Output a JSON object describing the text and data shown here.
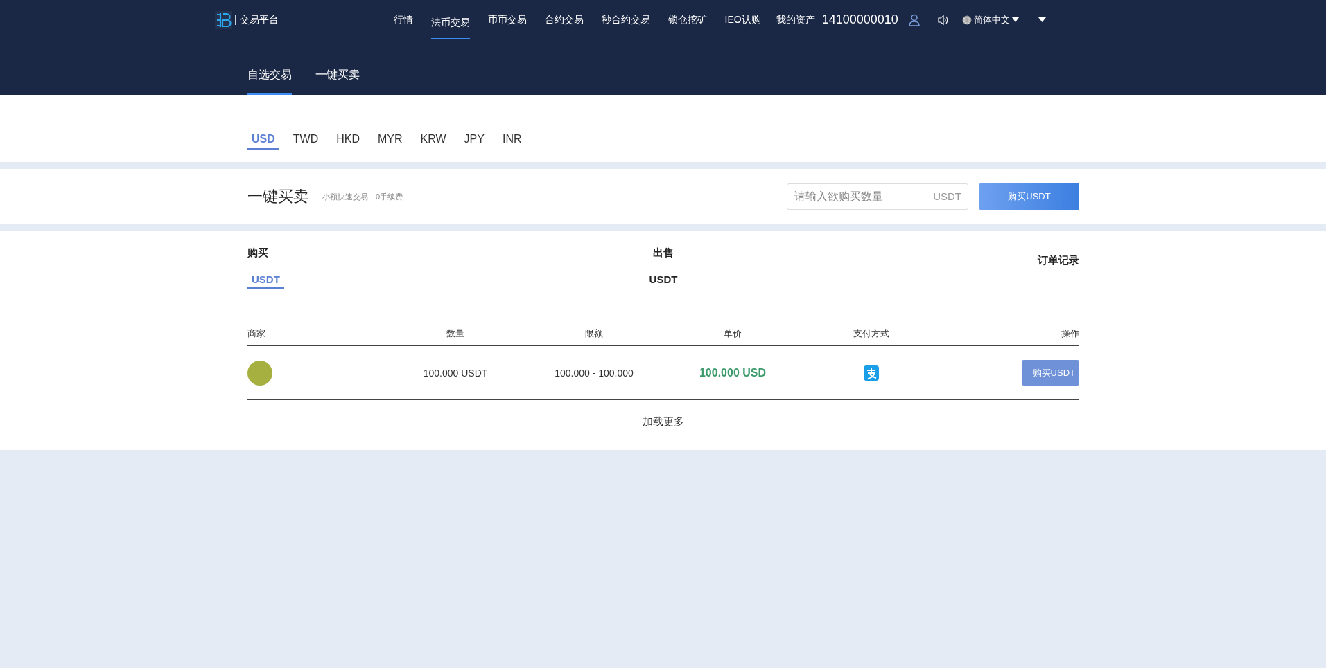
{
  "header": {
    "brand": "| 交易平台",
    "nav": [
      {
        "label": "行情",
        "selected": false
      },
      {
        "label": "法币交易",
        "selected": true
      },
      {
        "label": "币币交易",
        "selected": false
      },
      {
        "label": "合约交易",
        "selected": false
      },
      {
        "label": "秒合约交易",
        "selected": false
      },
      {
        "label": "锁仓挖矿",
        "selected": false
      },
      {
        "label": "IEO认购",
        "selected": false
      }
    ],
    "assets": "我的资产",
    "account": "14100000010",
    "language": "简体中文"
  },
  "sub_tabs": [
    {
      "label": "自选交易",
      "selected": true
    },
    {
      "label": "一键买卖",
      "selected": false
    }
  ],
  "currencies": [
    {
      "label": "USD",
      "selected": true
    },
    {
      "label": "TWD",
      "selected": false
    },
    {
      "label": "HKD",
      "selected": false
    },
    {
      "label": "MYR",
      "selected": false
    },
    {
      "label": "KRW",
      "selected": false
    },
    {
      "label": "JPY",
      "selected": false
    },
    {
      "label": "INR",
      "selected": false
    }
  ],
  "quick_trade": {
    "title": "一键买卖",
    "subtitle": "小额快速交易，0手续费",
    "placeholder": "请输入欲购买数量",
    "unit": "USDT",
    "button": "购买USDT"
  },
  "market": {
    "buy_label": "购买",
    "buy_coins": [
      {
        "label": "USDT",
        "selected": true
      }
    ],
    "sell_label": "出售",
    "sell_coins": [
      {
        "label": "USDT",
        "selected": false
      }
    ],
    "order_records": "订单记录"
  },
  "table": {
    "columns": [
      "商家",
      "数量",
      "限额",
      "单价",
      "支付方式",
      "操作"
    ],
    "rows": [
      {
        "quantity": "100.000 USDT",
        "limit": "100.000 - 100.000",
        "price": "100.000 USD",
        "action": "购买USDT"
      }
    ]
  },
  "load_more": "加载更多"
}
